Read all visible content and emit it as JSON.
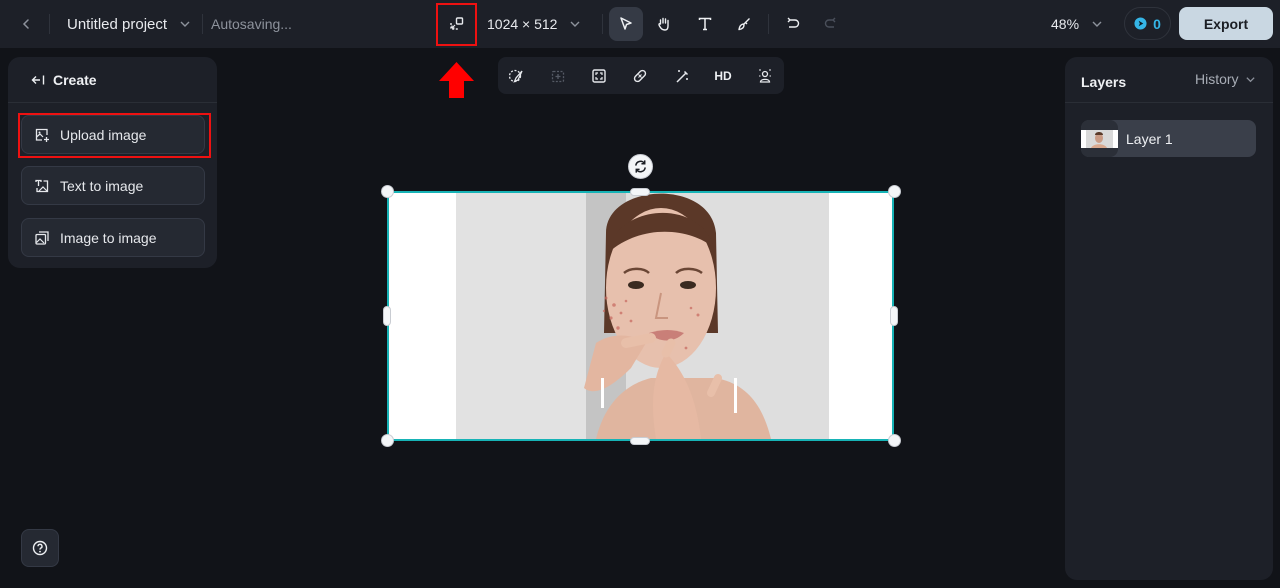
{
  "topbar": {
    "back_icon": "chevron-left-icon",
    "project_title": "Untitled project",
    "status": "Autosaving...",
    "resize_icon": "resize-canvas-icon",
    "canvas_size": "1024 × 512",
    "tools": [
      {
        "name": "select",
        "icon": "cursor-arrow-icon",
        "active": true
      },
      {
        "name": "hand",
        "icon": "hand-icon",
        "active": false
      },
      {
        "name": "text",
        "icon": "text-icon",
        "active": false
      },
      {
        "name": "brush",
        "icon": "brush-icon",
        "active": false
      }
    ],
    "undo_icon": "undo-icon",
    "redo_icon": "redo-icon",
    "zoom_level": "48%",
    "credits": "0",
    "export_label": "Export"
  },
  "subtoolbar": {
    "items": [
      {
        "name": "select-area",
        "icon": "lasso-brush-icon"
      },
      {
        "name": "add-frame",
        "icon": "add-frame-icon",
        "disabled": true
      },
      {
        "name": "crop",
        "icon": "crop-frame-icon"
      },
      {
        "name": "heal",
        "icon": "bandage-icon"
      },
      {
        "name": "magic",
        "icon": "magic-wand-icon"
      },
      {
        "name": "upscale",
        "label": "HD"
      },
      {
        "name": "remove-background",
        "icon": "person-cutout-icon"
      }
    ]
  },
  "left_panel": {
    "header": "Create",
    "options": [
      {
        "label": "Upload image",
        "icon": "upload-image-icon",
        "highlighted": true
      },
      {
        "label": "Text to image",
        "icon": "text-to-image-icon"
      },
      {
        "label": "Image to image",
        "icon": "image-to-image-icon"
      }
    ]
  },
  "right_panel": {
    "tab_layers": "Layers",
    "tab_history": "History",
    "layers": [
      {
        "name": "Layer 1",
        "selected": true
      }
    ]
  },
  "canvas": {
    "image_description": "Young woman with acne touching her cheek in front of a mirror",
    "selection_color": "#17b3b6"
  },
  "annotations": {
    "highlight_color": "#ee1111"
  }
}
